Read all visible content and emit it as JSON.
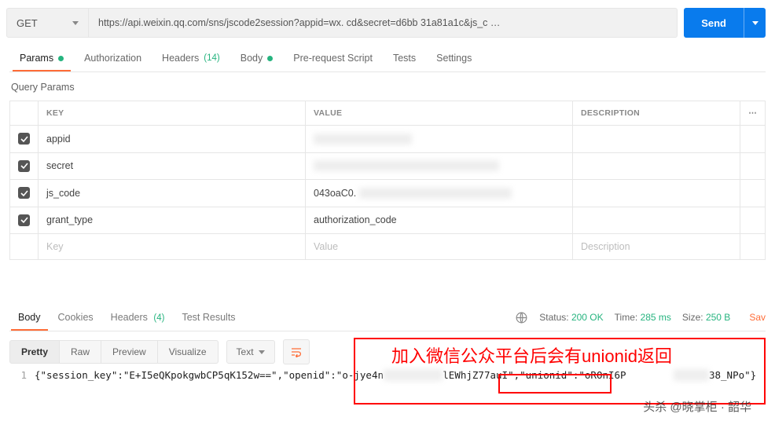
{
  "request": {
    "method": "GET",
    "url": "https://api.weixin.qq.com/sns/jscode2session?appid=wx.                         cd&secret=d6bb                            31a81a1c&js_c …",
    "send_label": "Send"
  },
  "tabs": {
    "params": "Params",
    "authorization": "Authorization",
    "headers": "Headers",
    "headers_count": "(14)",
    "body": "Body",
    "prerequest": "Pre-request Script",
    "tests": "Tests",
    "settings": "Settings"
  },
  "section": {
    "query_params": "Query Params"
  },
  "columns": {
    "key": "KEY",
    "value": "VALUE",
    "description": "DESCRIPTION"
  },
  "params": [
    {
      "enabled": true,
      "key": "appid",
      "value": ""
    },
    {
      "enabled": true,
      "key": "secret",
      "value": ""
    },
    {
      "enabled": true,
      "key": "js_code",
      "value": "043oaC0."
    },
    {
      "enabled": true,
      "key": "grant_type",
      "value": "authorization_code"
    }
  ],
  "param_placeholders": {
    "key": "Key",
    "value": "Value",
    "description": "Description"
  },
  "response_tabs": {
    "body": "Body",
    "cookies": "Cookies",
    "headers": "Headers",
    "headers_count": "(4)",
    "test_results": "Test Results"
  },
  "status": {
    "status_label": "Status:",
    "status_value": "200 OK",
    "time_label": "Time:",
    "time_value": "285 ms",
    "size_label": "Size:",
    "size_value": "250 B",
    "save": "Sav"
  },
  "view_modes": {
    "pretty": "Pretty",
    "raw": "Raw",
    "preview": "Preview",
    "visualize": "Visualize",
    "type": "Text"
  },
  "json": {
    "line_no": "1",
    "content_a": "{\"session_key\":\"E+I5eQKpokgwbCP5qK152w==\",\"openid\":\"o-jye4n",
    "content_b": "lEWhjZ77auI\",",
    "unionid_part": "\"unionid\":\"oROnI6P",
    "content_c": "38_NPo\"}"
  },
  "annotation": "加入微信公众平台后会有unionid返回",
  "watermark": "头杀 @晓掌柜 · 韶华"
}
